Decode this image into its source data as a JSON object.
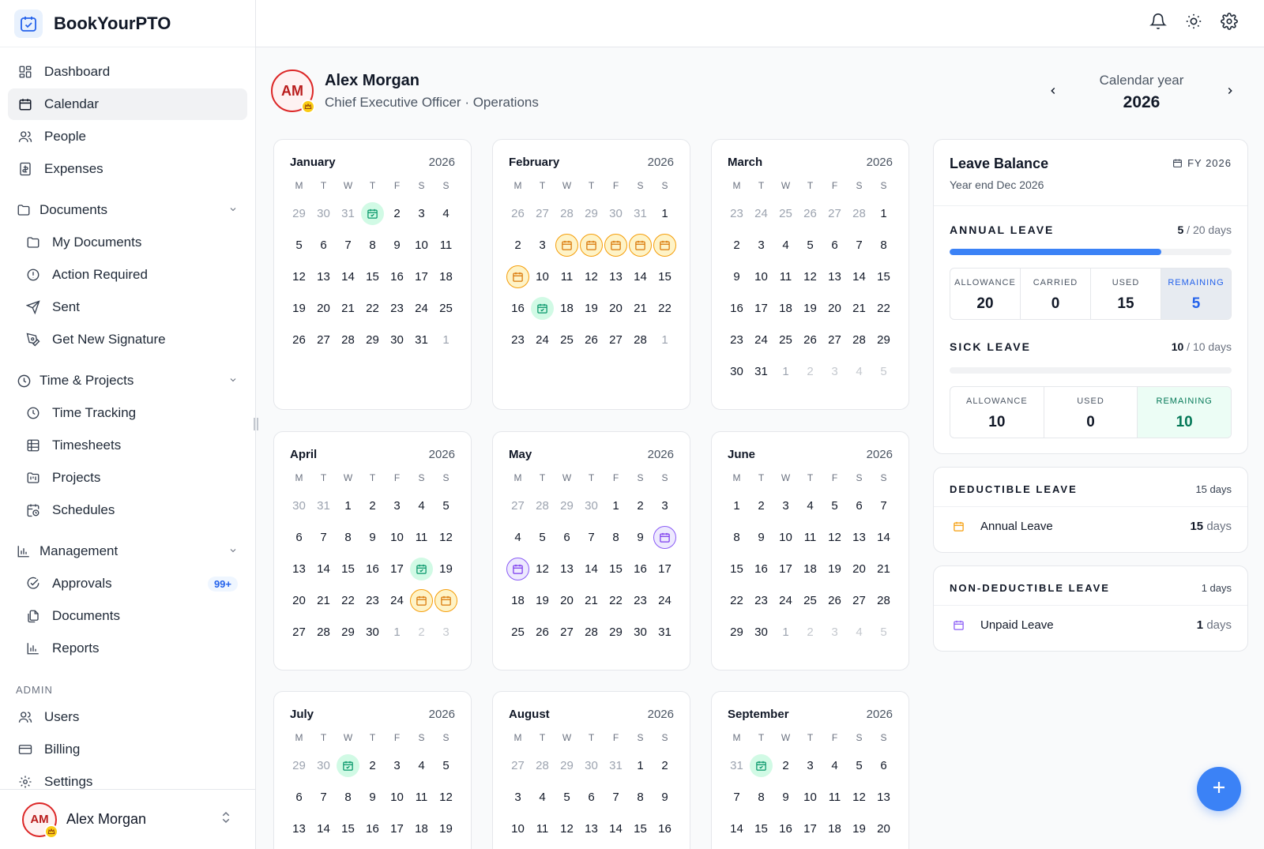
{
  "brand": {
    "name": "BookYourPTO"
  },
  "nav": {
    "dashboard": "Dashboard",
    "calendar": "Calendar",
    "people": "People",
    "expenses": "Expenses",
    "documents_section": "Documents",
    "my_documents": "My Documents",
    "action_required": "Action Required",
    "sent": "Sent",
    "get_new_signature": "Get New Signature",
    "time_section": "Time & Projects",
    "time_tracking": "Time Tracking",
    "timesheets": "Timesheets",
    "projects": "Projects",
    "schedules": "Schedules",
    "management_section": "Management",
    "approvals": "Approvals",
    "approvals_badge": "99+",
    "documents": "Documents",
    "reports": "Reports",
    "admin_label": "ADMIN",
    "users": "Users",
    "billing": "Billing",
    "settings": "Settings"
  },
  "user": {
    "initials": "AM",
    "name": "Alex Morgan"
  },
  "profile": {
    "initials": "AM",
    "name": "Alex Morgan",
    "role": "Chief Executive Officer · Operations"
  },
  "year_nav": {
    "label": "Calendar year",
    "year": "2026"
  },
  "weekdays": [
    "M",
    "T",
    "W",
    "T",
    "F",
    "S",
    "S"
  ],
  "months": [
    {
      "name": "January",
      "year": "2026",
      "lead": [
        29,
        30,
        31
      ],
      "days": 31,
      "trail": [
        1
      ],
      "marks": {
        "1": "holiday"
      }
    },
    {
      "name": "February",
      "year": "2026",
      "lead": [
        26,
        27,
        28,
        29,
        30,
        31
      ],
      "days": 28,
      "trail": [
        1
      ],
      "marks": {
        "4": "annual",
        "5": "annual",
        "6": "annual",
        "7": "annual",
        "8": "annual",
        "9": "annual",
        "17": "holiday"
      }
    },
    {
      "name": "March",
      "year": "2026",
      "lead": [
        23,
        24,
        25,
        26,
        27,
        28
      ],
      "days": 31,
      "trail": [
        1,
        2,
        3,
        4,
        5
      ],
      "marks": {}
    },
    {
      "name": "April",
      "year": "2026",
      "lead": [
        30,
        31
      ],
      "days": 30,
      "trail": [
        1,
        2,
        3
      ],
      "marks": {
        "18": "holiday",
        "25": "annual",
        "26": "annual"
      }
    },
    {
      "name": "May",
      "year": "2026",
      "lead": [
        27,
        28,
        29,
        30
      ],
      "days": 31,
      "trail": [],
      "marks": {
        "10": "unpaid",
        "11": "unpaid"
      }
    },
    {
      "name": "June",
      "year": "2026",
      "lead": [],
      "days": 30,
      "trail": [
        1,
        2,
        3,
        4,
        5
      ],
      "marks": {}
    },
    {
      "name": "July",
      "year": "2026",
      "lead": [
        29,
        30
      ],
      "days": 19,
      "trail": [],
      "marks": {
        "1": "holiday"
      }
    },
    {
      "name": "August",
      "year": "2026",
      "lead": [
        27,
        28,
        29,
        30,
        31
      ],
      "days": 16,
      "trail": [],
      "marks": {}
    },
    {
      "name": "September",
      "year": "2026",
      "lead": [
        31
      ],
      "days": 20,
      "trail": [],
      "marks": {
        "1": "holiday"
      }
    }
  ],
  "leave_balance": {
    "title": "Leave Balance",
    "subtitle": "Year end Dec 2026",
    "fy": "FY 2026",
    "annual": {
      "label": "ANNUAL LEAVE",
      "used": "5",
      "total": "/ 20 days",
      "progress": 0.75,
      "stats": [
        {
          "label": "ALLOWANCE",
          "value": "20"
        },
        {
          "label": "CARRIED",
          "value": "0"
        },
        {
          "label": "USED",
          "value": "15"
        },
        {
          "label": "REMAINING",
          "value": "5"
        }
      ]
    },
    "sick": {
      "label": "SICK LEAVE",
      "used": "10",
      "total": "/ 10 days",
      "progress": 0,
      "stats": [
        {
          "label": "ALLOWANCE",
          "value": "10"
        },
        {
          "label": "USED",
          "value": "0"
        },
        {
          "label": "REMAINING",
          "value": "10"
        }
      ]
    }
  },
  "deductible": {
    "label": "DEDUCTIBLE LEAVE",
    "total": "15 days",
    "item": "Annual Leave",
    "item_days": "15",
    "item_unit": "days"
  },
  "non_deductible": {
    "label": "NON-DEDUCTIBLE LEAVE",
    "total": "1 days",
    "item": "Unpaid Leave",
    "item_days": "1",
    "item_unit": "days"
  },
  "colors": {
    "accent": "#3b82f6",
    "holiday": "#d1fae5",
    "annual": "#f59e0b",
    "unpaid": "#8b5cf6",
    "avatar_border": "#dc2626"
  }
}
